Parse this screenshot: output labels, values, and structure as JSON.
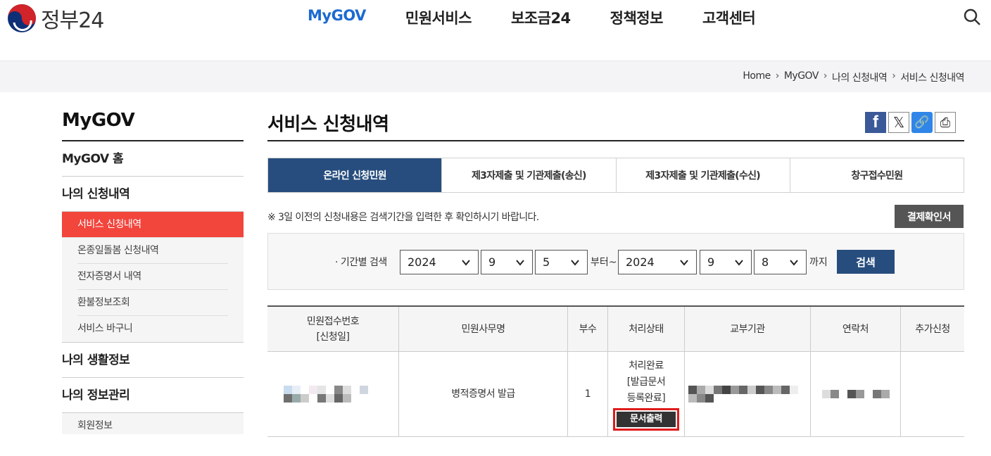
{
  "header": {
    "logo_text": "정부24",
    "nav": [
      "MyGOV",
      "민원서비스",
      "보조금24",
      "정책정보",
      "고객센터"
    ],
    "active_nav": "MyGOV"
  },
  "breadcrumb": [
    "Home",
    "MyGOV",
    "나의 신청내역",
    "서비스 신청내역"
  ],
  "sidebar": {
    "title": "MyGOV",
    "items": [
      {
        "label": "MyGOV 홈"
      },
      {
        "label": "나의 신청내역",
        "subs": [
          "서비스 신청내역",
          "온종일돌봄 신청내역",
          "전자증명서 내역",
          "환불정보조회",
          "서비스 바구니"
        ]
      },
      {
        "label": "나의 생활정보"
      },
      {
        "label": "나의 정보관리",
        "subs": [
          "회원정보"
        ]
      }
    ]
  },
  "main": {
    "title": "서비스 신청내역",
    "share_icons": [
      "facebook-icon",
      "x-icon",
      "link-icon",
      "print-icon"
    ],
    "tabs": [
      "온라인 신청민원",
      "제3자제출 및 기관제출(송신)",
      "제3자제출 및 기관제출(수신)",
      "창구접수민원"
    ],
    "notice": "※ 3일 이전의 신청내용은 검색기간을 입력한 후 확인하시기 바랍니다.",
    "confirm_button": "결제확인서",
    "filter": {
      "label": "· 기간별 검색",
      "from_year": "2024",
      "from_month": "9",
      "from_day": "5",
      "from_suffix": "부터~",
      "to_year": "2024",
      "to_month": "9",
      "to_day": "8",
      "to_suffix": "까지",
      "search_button": "검색"
    },
    "table": {
      "headers": [
        "민원접수번호\n[신청일]",
        "민원사무명",
        "부수",
        "처리상태",
        "교부기관",
        "연락처",
        "추가신청"
      ],
      "rows": [
        {
          "service": "병적증명서 발급",
          "copies": "1",
          "status_lines": [
            "처리완료",
            "[발급문서",
            "등록완료]"
          ],
          "action": "문서출력"
        }
      ]
    }
  },
  "colors": {
    "accent_blue": "#1c6ad1",
    "tab_active": "#264d7d",
    "sidebar_active": "#f2453c",
    "highlight_border": "#e01a1a"
  }
}
